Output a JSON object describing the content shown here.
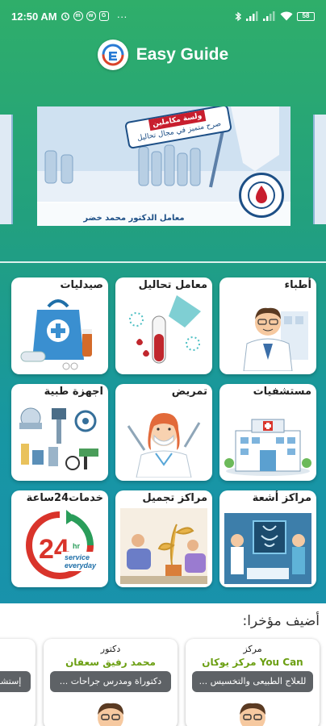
{
  "status_bar": {
    "time": "12:50 AM",
    "battery": "58"
  },
  "header": {
    "title": "Easy Guide"
  },
  "carousel": {
    "banner_line1": "ولسة مكاملين",
    "banner_line2": "صرح متميز في مجال تحاليل",
    "footer": "معامل الدكتور محمد خضر"
  },
  "categories": [
    {
      "label": "أطباء",
      "icon": "doctor"
    },
    {
      "label": "معامل تحاليل",
      "icon": "lab-test"
    },
    {
      "label": "صيدليات",
      "icon": "pharmacy-bag"
    },
    {
      "label": "مستشفيات",
      "icon": "hospital-building"
    },
    {
      "label": "تمريض",
      "icon": "nurse"
    },
    {
      "label": "اجهزة طبية",
      "icon": "medical-devices"
    },
    {
      "label": "مراكز أشعة",
      "icon": "radiology"
    },
    {
      "label": "مراكز تجميل",
      "icon": "beauty-salon"
    },
    {
      "label": "خدمات24ساعة",
      "icon": "24-hours"
    }
  ],
  "service_24": {
    "number": "24",
    "line1": "hr",
    "line2": "service",
    "line3": "everyday"
  },
  "recent": {
    "title": "أضيف مؤخرا:",
    "items": [
      {
        "type": "مركز",
        "name": "مركز يوكان You Can",
        "desc": "للعلاج الطبيعى والتخسيس ..."
      },
      {
        "type": "دكتور",
        "name": "محمد رفيق سعفان",
        "desc": "دكتوراة ومدرس جراحات ..."
      },
      {
        "type": "",
        "name": "",
        "desc": "إستشا"
      }
    ]
  },
  "colors": {
    "gradient_top": "#2fae6a",
    "gradient_bottom": "#1a8fb1",
    "name_green": "#6b9f12",
    "desc_gray": "#5e6266"
  }
}
